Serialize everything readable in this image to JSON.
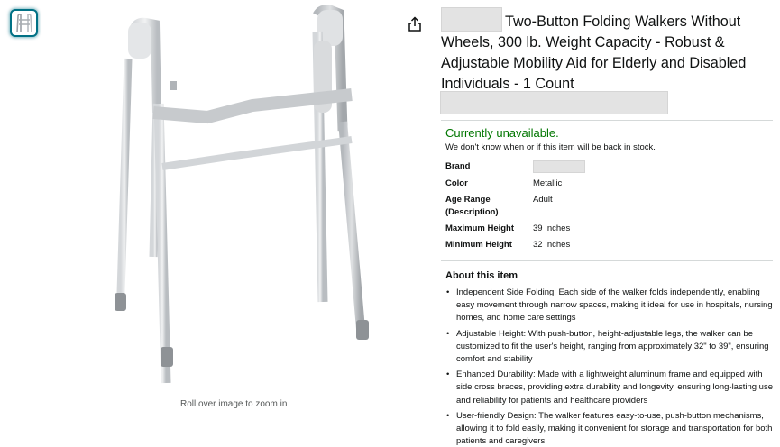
{
  "gallery": {
    "thumbnail_icon": "walker-thumbnail",
    "main_image_icon": "folding-walker-image",
    "zoom_hint": "Roll over image to zoom in"
  },
  "share_icon": "share-icon",
  "product": {
    "title": "Two-Button Folding Walkers Without Wheels, 300 lb. Weight Capacity - Robust & Adjustable Mobility Aid for Elderly and Disabled Individuals - 1 Count"
  },
  "availability": {
    "status": "Currently unavailable.",
    "note": "We don't know when or if this item will be back in stock.",
    "status_color": "#007600"
  },
  "specs": [
    {
      "key": "Brand",
      "value": ""
    },
    {
      "key": "Color",
      "value": "Metallic"
    },
    {
      "key": "Age Range (Description)",
      "value": "Adult"
    },
    {
      "key": "Maximum Height",
      "value": "39 Inches"
    },
    {
      "key": "Minimum Height",
      "value": "32 Inches"
    }
  ],
  "about": {
    "title": "About this item",
    "bullets": [
      "Independent Side Folding: Each side of the walker folds independently, enabling easy movement through narrow spaces, making it ideal for use in hospitals, nursing homes, and home care settings",
      "Adjustable Height: With push-button, height-adjustable legs, the walker can be customized to fit the user's height, ranging from approximately 32\" to 39\", ensuring comfort and stability",
      "Enhanced Durability: Made with a lightweight aluminum frame and equipped with side cross braces, providing extra durability and longevity, ensuring long-lasting use and reliability for patients and healthcare providers",
      "User-friendly Design: The walker features easy-to-use, push-button mechanisms, allowing it to fold easily, making it convenient for storage and transportation for both patients and caregivers"
    ]
  }
}
